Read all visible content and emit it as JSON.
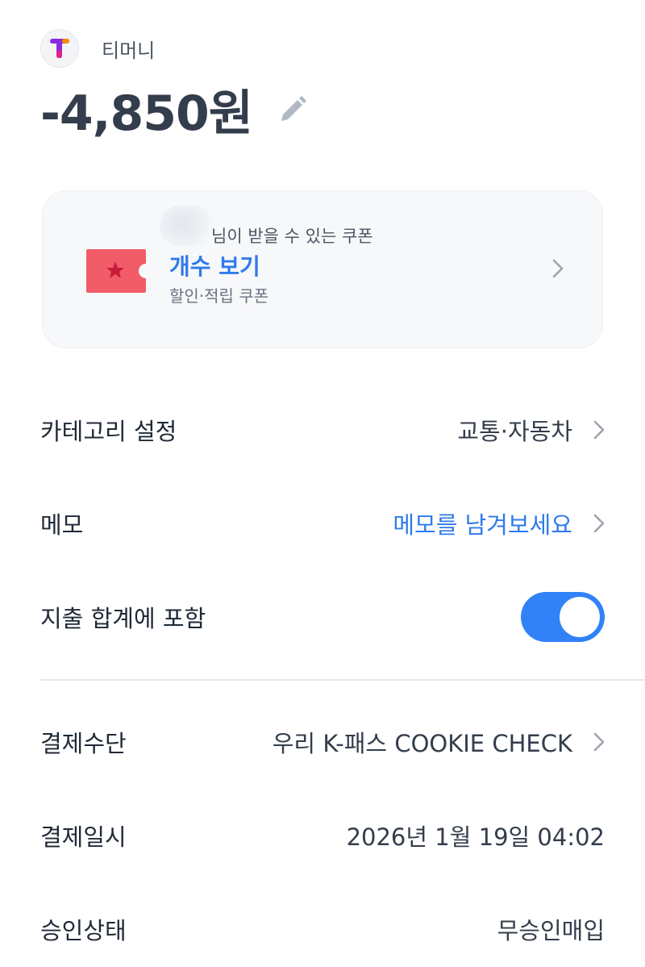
{
  "merchant": {
    "name": "티머니",
    "logo_icon": "tmoney-logo-icon"
  },
  "transaction": {
    "amount": "-4,850원",
    "edit_icon": "pencil-icon"
  },
  "coupon": {
    "line1": "님이 받을 수 있는 쿠폰",
    "line2": "개수 보기",
    "line3": "할인·적립 쿠폰",
    "ticket_icon": "coupon-ticket-icon",
    "ticket_color": "#f25c68",
    "accent_color": "#2f7bea"
  },
  "rows": {
    "category": {
      "label": "카테고리 설정",
      "value": "교통·자동차"
    },
    "memo": {
      "label": "메모",
      "value": "메모를 남겨보세요"
    },
    "include_total": {
      "label": "지출 합계에 포함",
      "toggle_on": true,
      "toggle_color": "#3182f6"
    },
    "payment_method": {
      "label": "결제수단",
      "value": "우리 K-패스 COOKIE CHECK"
    },
    "payment_date": {
      "label": "결제일시",
      "value": "2026년 1월 19일 04:02"
    },
    "approval_status": {
      "label": "승인상태",
      "value": "무승인매입"
    }
  }
}
